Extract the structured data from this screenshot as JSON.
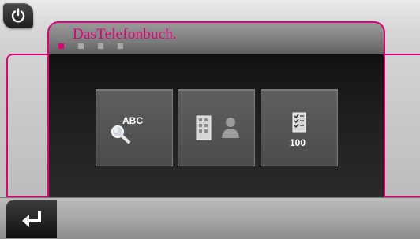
{
  "header": {
    "brand": "DasTelefonbuch.",
    "page_indicator": {
      "total": 4,
      "active_index": 0
    }
  },
  "icons": {
    "power": "power-icon",
    "search": "magnifier-icon",
    "building": "building-icon",
    "person": "person-icon",
    "list": "checklist-icon",
    "back": "return-arrow-icon"
  },
  "tiles": [
    {
      "id": "search-by-name",
      "label": "ABC"
    },
    {
      "id": "search-business",
      "label": ""
    },
    {
      "id": "result-count",
      "label": "100"
    }
  ],
  "colors": {
    "accent": "#e0007a"
  }
}
